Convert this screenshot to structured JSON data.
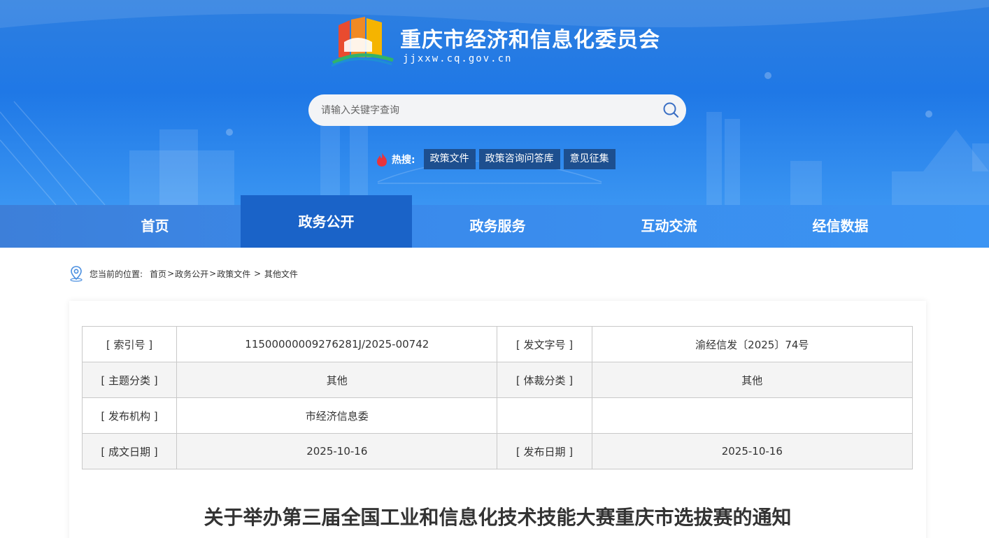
{
  "header": {
    "site_title": "重庆市经济和信息化委员会",
    "site_domain": "jjxxw.cq.gov.cn",
    "search_placeholder": "请输入关键字查询",
    "hot_label": "热搜:",
    "hot_tags": [
      "政策文件",
      "政策咨询问答库",
      "意见征集"
    ]
  },
  "nav": {
    "items": [
      "首页",
      "政务公开",
      "政务服务",
      "互动交流",
      "经信数据"
    ],
    "active_index": 1
  },
  "breadcrumb": {
    "label": "您当前的位置:",
    "items": [
      "首页",
      "政务公开",
      "政策文件",
      "其他文件"
    ]
  },
  "meta_table": [
    {
      "k1": "[ 索引号 ]",
      "v1": "11500000009276281J/2025-00742",
      "k2": "[ 发文字号 ]",
      "v2": "渝经信发〔2025〕74号"
    },
    {
      "k1": "[ 主题分类 ]",
      "v1": "其他",
      "k2": "[ 体裁分类 ]",
      "v2": "其他"
    },
    {
      "k1": "[ 发布机构 ]",
      "v1": "市经济信息委",
      "k2": "",
      "v2": ""
    },
    {
      "k1": "[ 成文日期 ]",
      "v1": "2025-10-16",
      "k2": "[ 发布日期 ]",
      "v2": "2025-10-16"
    }
  ],
  "article": {
    "title": "关于举办第三届全国工业和信息化技术技能大赛重庆市选拔赛的通知"
  },
  "colors": {
    "header_blue": "#1f78e6",
    "nav_active": "#1a63c8",
    "hot_tag_bg": "#1d4f8f"
  }
}
